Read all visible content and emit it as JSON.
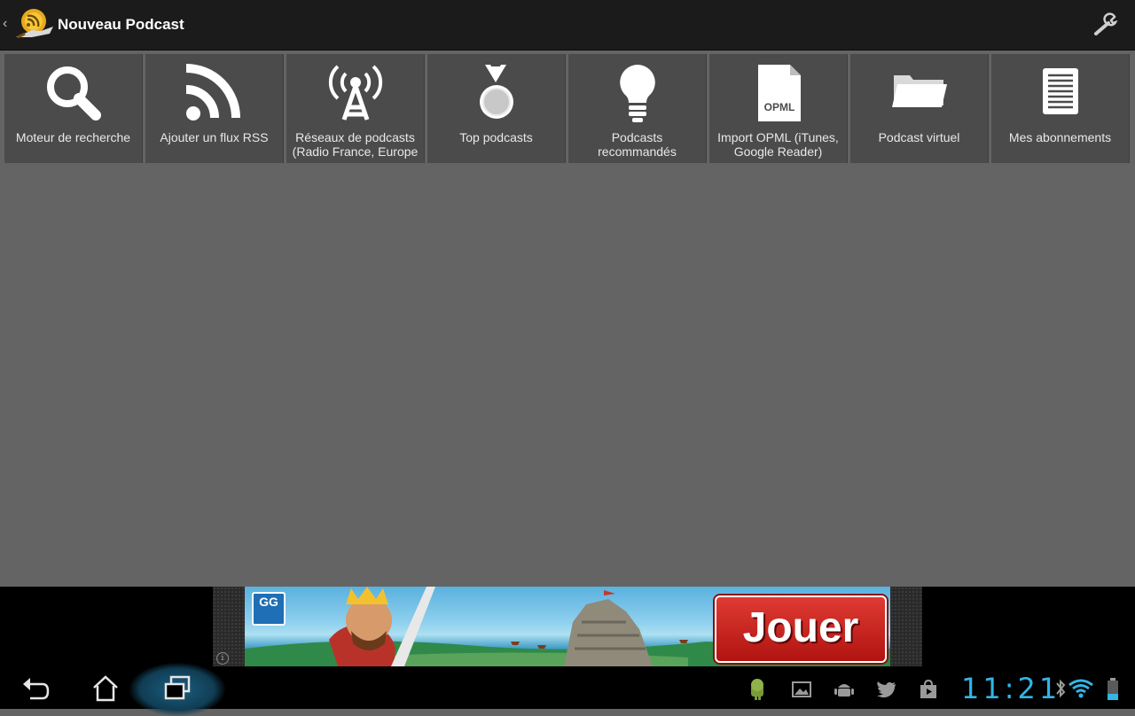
{
  "app": {
    "title": "Nouveau Podcast",
    "up_caret": "‹"
  },
  "tiles": [
    {
      "label": "Moteur de recherche",
      "icon": "search-icon"
    },
    {
      "label": "Ajouter un flux RSS",
      "icon": "rss-icon"
    },
    {
      "label": "Reseaux de podcasts (Radio France, Europe",
      "label_display": "Réseaux de podcasts (Radio France, Europe",
      "icon": "antenna-icon"
    },
    {
      "label": "Top podcasts",
      "icon": "medal-icon"
    },
    {
      "label": "Podcasts recommandés",
      "icon": "lightbulb-icon"
    },
    {
      "label": "Import OPML (iTunes, Google Reader)",
      "icon": "opml-file-icon",
      "icon_text": "OPML"
    },
    {
      "label": "Podcast virtuel",
      "icon": "folder-icon"
    },
    {
      "label": "Mes abonnements",
      "icon": "list-document-icon"
    }
  ],
  "ad": {
    "logo_text": "GG",
    "button_label": "Jouer",
    "info_glyph": "i"
  },
  "system": {
    "clock": "11:21"
  },
  "colors": {
    "background": "#646464",
    "tile": "#4b4b4b",
    "action_bar": "#1b1b1b",
    "accent_blue": "#33b5e5",
    "ad_red": "#c41e1a"
  }
}
